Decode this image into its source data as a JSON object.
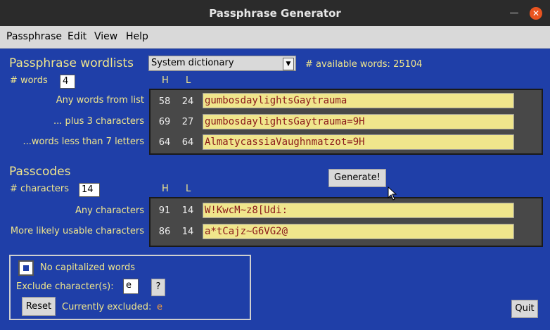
{
  "window": {
    "title": "Passphrase Generator"
  },
  "menu": [
    "Passphrase",
    "Edit",
    "View",
    "Help"
  ],
  "wordlists": {
    "heading": "Passphrase wordlists",
    "combo_value": "System dictionary",
    "available": "# available words: 25104",
    "words_label": "# words",
    "words_value": "4",
    "col_h": "H",
    "col_l": "L",
    "rows": [
      {
        "label": "Any words from list",
        "h": "58",
        "l": "24",
        "value": "gumbosdaylightsGaytrauma"
      },
      {
        "label": "... plus 3 characters",
        "h": "69",
        "l": "27",
        "value": "gumbosdaylightsGaytrauma=9H"
      },
      {
        "label": "...words less than 7 letters",
        "h": "64",
        "l": "64",
        "value": "AlmatycassiaVaughnmatzot=9H"
      }
    ]
  },
  "passcodes": {
    "heading": "Passcodes",
    "chars_label": "# characters",
    "chars_value": "14",
    "col_h": "H",
    "col_l": "L",
    "rows": [
      {
        "label": "Any characters",
        "h": "91",
        "l": "14",
        "value": "W!KwcM~z8[Udi:"
      },
      {
        "label": "More likely usable characters",
        "h": "86",
        "l": "14",
        "value": "a*tCajz~G6VG2@"
      }
    ]
  },
  "generate_label": "Generate!",
  "options": {
    "no_caps_label": "No capitalized words",
    "exclude_label": "Exclude character(s):",
    "exclude_value": "e",
    "help_label": "?",
    "reset_label": "Reset",
    "currently_excluded_label": "Currently excluded:",
    "currently_excluded_value": "e"
  },
  "quit_label": "Quit"
}
